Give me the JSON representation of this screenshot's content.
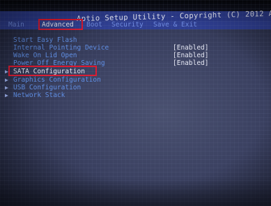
{
  "title": "Aptio Setup Utility - Copyright (C) 2012 Americ",
  "menu": [
    {
      "label": "Main",
      "active": false
    },
    {
      "label": "Advanced",
      "active": true
    },
    {
      "label": "Boot",
      "active": false
    },
    {
      "label": "Security",
      "active": false
    },
    {
      "label": "Save & Exit",
      "active": false
    }
  ],
  "items": [
    {
      "label": "Start Easy Flash",
      "value": ""
    },
    {
      "label": "Internal Pointing Device",
      "value": "[Enabled]"
    },
    {
      "label": "Wake On Lid Open",
      "value": "[Enabled]"
    },
    {
      "label": "Power Off Energy Saving",
      "value": "[Enabled]"
    },
    {
      "label": "SATA Configuration",
      "value": "",
      "selected": true
    },
    {
      "label": "Graphics Configuration",
      "value": ""
    },
    {
      "label": "USB Configuration",
      "value": ""
    },
    {
      "label": "Network Stack",
      "value": ""
    }
  ],
  "submenu_arrow": "▶",
  "colors": {
    "title_bar": "#2b3a8c",
    "menu_bar": "#2f3f93",
    "highlight": "#e0182d",
    "item_text": "#5f8fe6",
    "value_text": "#e8eaf6"
  }
}
